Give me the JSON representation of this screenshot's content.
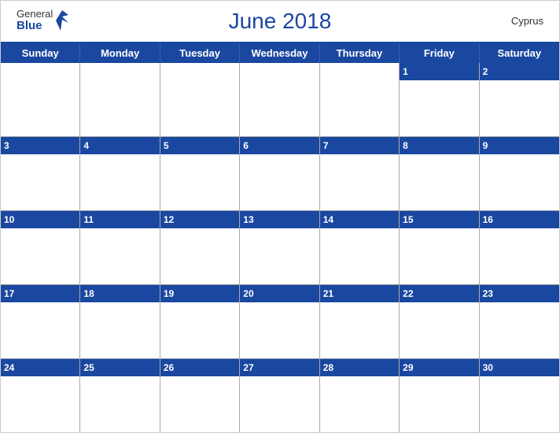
{
  "header": {
    "title": "June 2018",
    "country": "Cyprus",
    "logo_general": "General",
    "logo_blue": "Blue"
  },
  "days": {
    "headers": [
      "Sunday",
      "Monday",
      "Tuesday",
      "Wednesday",
      "Thursday",
      "Friday",
      "Saturday"
    ]
  },
  "weeks": [
    [
      null,
      null,
      null,
      null,
      null,
      1,
      2
    ],
    [
      3,
      4,
      5,
      6,
      7,
      8,
      9
    ],
    [
      10,
      11,
      12,
      13,
      14,
      15,
      16
    ],
    [
      17,
      18,
      19,
      20,
      21,
      22,
      23
    ],
    [
      24,
      25,
      26,
      27,
      28,
      29,
      30
    ]
  ]
}
